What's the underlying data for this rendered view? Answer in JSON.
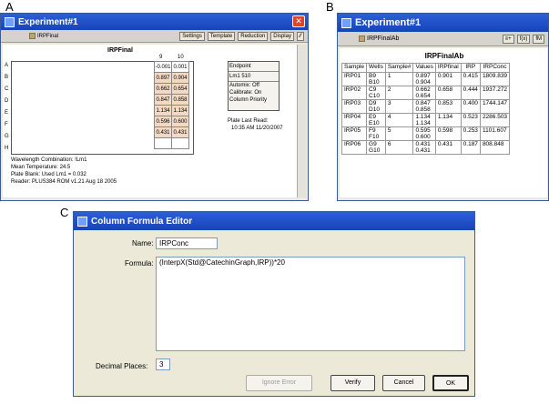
{
  "panel_labels": {
    "a": "A",
    "b": "B",
    "c": "C"
  },
  "win_a": {
    "title": "Experiment#1",
    "toolbar": {
      "name": "IRPFinal",
      "settings": "Settings",
      "template": "Template",
      "reduction": "Reduction",
      "display": "Display"
    },
    "heading": "IRPFinal",
    "col_headers": [
      "9",
      "10"
    ],
    "row_labels": [
      "A",
      "B",
      "C",
      "D",
      "E",
      "F",
      "G",
      "H"
    ],
    "cells": [
      [
        "-0.001",
        "0.001"
      ],
      [
        "0.897",
        "0.904"
      ],
      [
        "0.662",
        "0.654"
      ],
      [
        "0.847",
        "0.858"
      ],
      [
        "1.134",
        "1.134"
      ],
      [
        "0.596",
        "0.600"
      ],
      [
        "0.431",
        "0.431"
      ]
    ],
    "info": {
      "endpoint": "Endpoint",
      "lm": "Lm1  510",
      "automix": "Automix: Off",
      "calibrate": "Calibrate: On",
      "priority": "Column Priority"
    },
    "plate_last_read": "Plate Last Read:",
    "plate_time": "10:35 AM  11/20/2007",
    "footer": [
      "Wavelength Combination: !Lm1",
      "Mean Temperature: 24.5",
      "Plate Blank: Used  Lm1 = 0.032",
      "Reader: PLUS384 ROM v1.21 Aug 18 2005"
    ]
  },
  "win_b": {
    "title": "Experiment#1",
    "toolbar_name": "IRPFinalAb",
    "heading": "IRPFinalAb",
    "headers": [
      "Sample",
      "Wells",
      "Sample#",
      "Values",
      "IRPfinal",
      "IRP",
      "IRPConc"
    ],
    "rows": [
      {
        "sample": "IRP01",
        "wells": [
          "B9",
          "B10"
        ],
        "num": "1",
        "values": [
          "0.897",
          "0.904"
        ],
        "final": "0.901",
        "irp": "0.415",
        "conc": "1809.839"
      },
      {
        "sample": "IRP02",
        "wells": [
          "C9",
          "C10"
        ],
        "num": "2",
        "values": [
          "0.662",
          "0.654"
        ],
        "final": "0.658",
        "irp": "0.444",
        "conc": "1937.272"
      },
      {
        "sample": "IRP03",
        "wells": [
          "D9",
          "D10"
        ],
        "num": "3",
        "values": [
          "0.847",
          "0.858"
        ],
        "final": "0.853",
        "irp": "0.400",
        "conc": "1744.147"
      },
      {
        "sample": "IRP04",
        "wells": [
          "E9",
          "E10"
        ],
        "num": "4",
        "values": [
          "1.134",
          "1.134"
        ],
        "final": "1.134",
        "irp": "0.523",
        "conc": "2286.503"
      },
      {
        "sample": "IRP05",
        "wells": [
          "F9",
          "F10"
        ],
        "num": "5",
        "values": [
          "0.595",
          "0.600"
        ],
        "final": "0.598",
        "irp": "0.253",
        "conc": "1101.607"
      },
      {
        "sample": "IRP06",
        "wells": [
          "G9",
          "G10"
        ],
        "num": "6",
        "values": [
          "0.431",
          "0.431"
        ],
        "final": "0.431",
        "irp": "0.187",
        "conc": "808.848"
      }
    ]
  },
  "win_c": {
    "title": "Column Formula Editor",
    "name_label": "Name:",
    "name_value": "IRPConc",
    "formula_label": "Formula:",
    "formula_value": "(InterpX(Std@CatechinGraph,IRP))*20",
    "decimal_label": "Decimal Places:",
    "decimal_value": "3",
    "buttons": {
      "ignore": "Ignore Error",
      "verify": "Verify",
      "cancel": "Cancel",
      "ok": "OK"
    }
  }
}
